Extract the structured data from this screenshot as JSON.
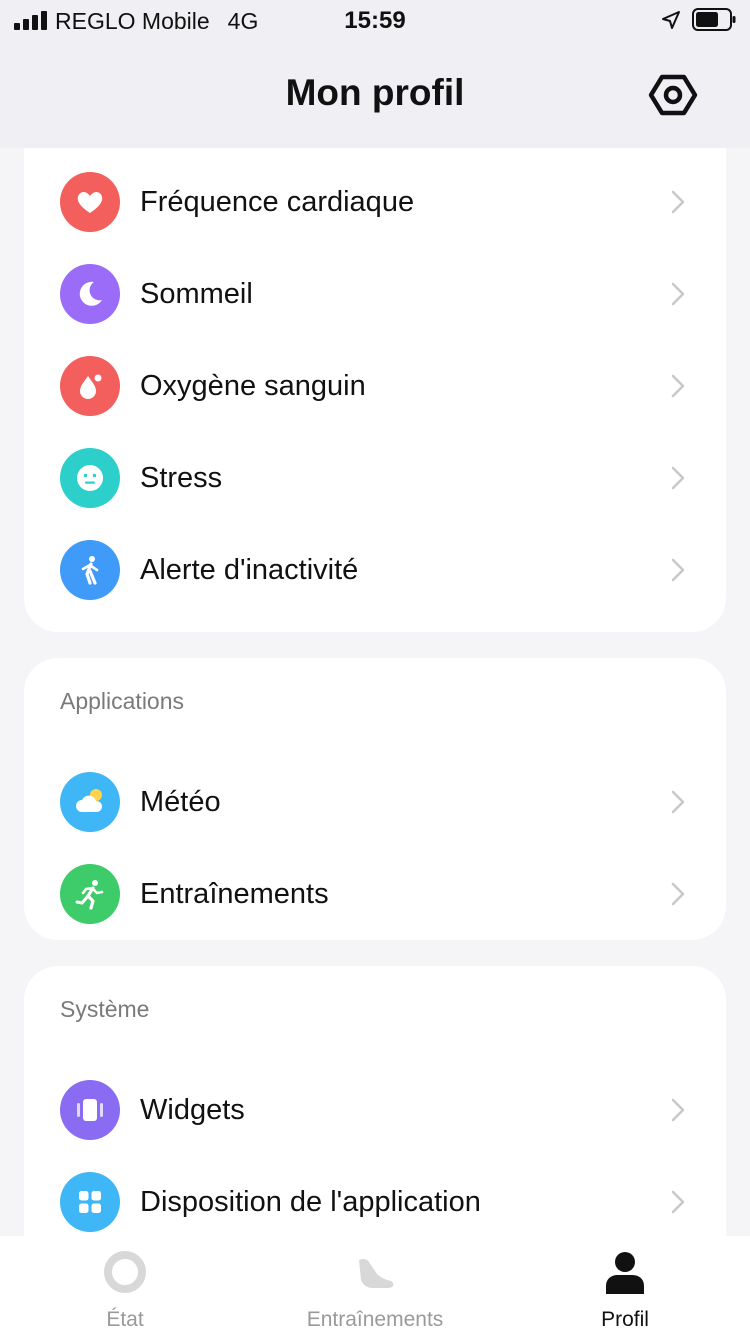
{
  "status_bar": {
    "carrier": "REGLO Mobile",
    "network": "4G",
    "time": "15:59"
  },
  "header": {
    "title": "Mon profil",
    "settings_icon": "settings-hexagon-icon"
  },
  "health": {
    "items": [
      {
        "label": "Fréquence cardiaque",
        "icon": "heart-icon",
        "color": "#f25f5c"
      },
      {
        "label": "Sommeil",
        "icon": "moon-icon",
        "color": "#9b6cf7"
      },
      {
        "label": "Oxygène sanguin",
        "icon": "blood-drop-icon",
        "color": "#f25f5c"
      },
      {
        "label": "Stress",
        "icon": "face-icon",
        "color": "#2ccfc9"
      },
      {
        "label": "Alerte d'inactivité",
        "icon": "person-walk-icon",
        "color": "#3f9bf7"
      }
    ]
  },
  "applications": {
    "title": "Applications",
    "items": [
      {
        "label": "Météo",
        "icon": "weather-icon",
        "color": "#3fb6f5"
      },
      {
        "label": "Entraînements",
        "icon": "runner-icon",
        "color": "#3ecb6a"
      }
    ]
  },
  "system": {
    "title": "Système",
    "items": [
      {
        "label": "Widgets",
        "icon": "widgets-icon",
        "color": "#8a6cf2"
      },
      {
        "label": "Disposition de l'application",
        "icon": "grid-icon",
        "color": "#3fb6f5"
      }
    ]
  },
  "tabs": [
    {
      "label": "État",
      "active": false
    },
    {
      "label": "Entraînements",
      "active": false
    },
    {
      "label": "Profil",
      "active": true
    }
  ],
  "colors": {
    "active_tab": "#111111",
    "inactive_tab": "#9a9a9a",
    "chevron": "#c8c8cc"
  }
}
